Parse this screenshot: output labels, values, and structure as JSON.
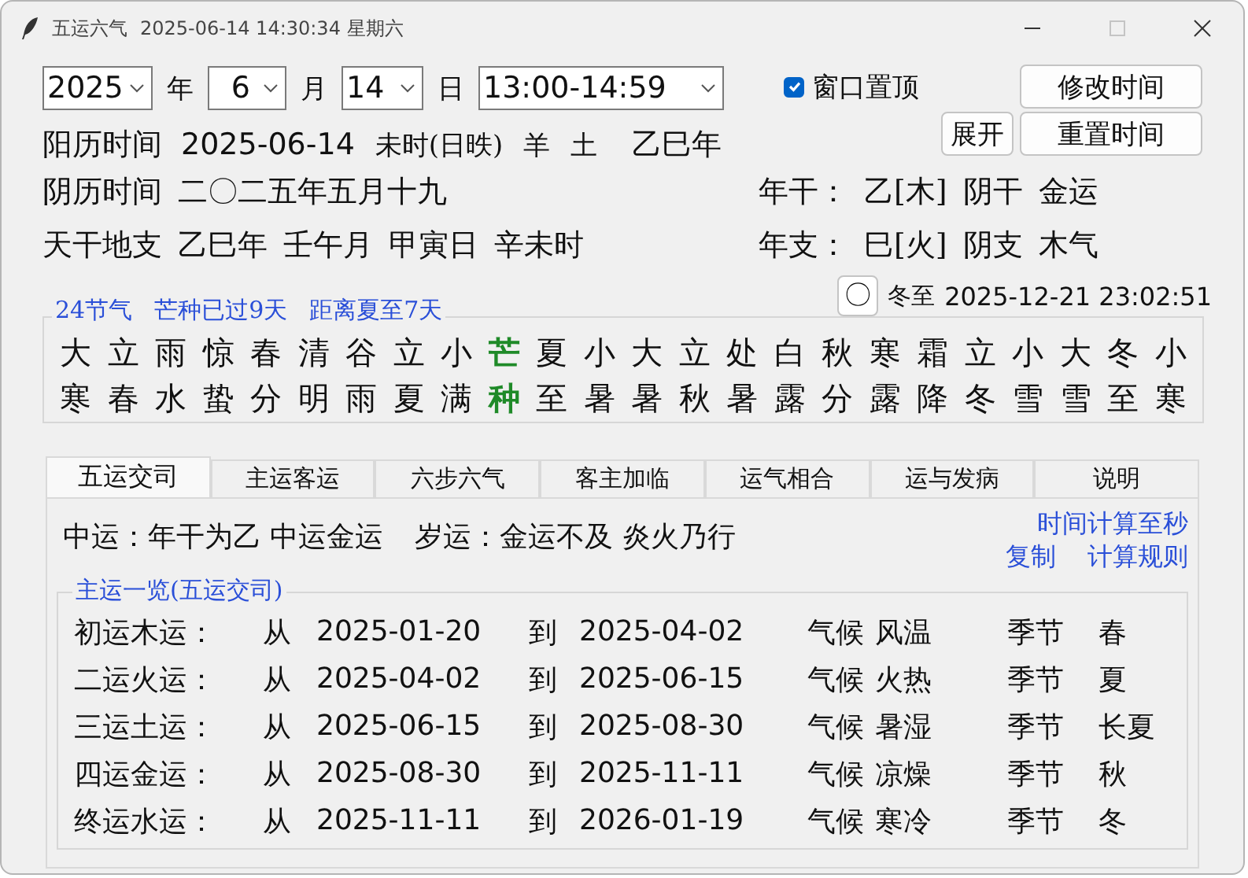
{
  "window": {
    "title": "五运六气",
    "timestamp": "2025-06-14 14:30:34 星期六",
    "maximize_disabled": true
  },
  "date_controls": {
    "year": "2025",
    "year_label": "年",
    "month": "6",
    "month_label": "月",
    "day": "14",
    "day_label": "日",
    "hour": "13:00-14:59"
  },
  "always_on_top": {
    "label": "窗口置顶",
    "checked": true
  },
  "buttons": {
    "modify": "修改时间",
    "expand": "展开",
    "reset": "重置时间"
  },
  "solar": {
    "label": "阳历时间",
    "date": "2025-06-14",
    "hour": "未时(日昳)",
    "zodiac": "羊",
    "element": "土",
    "year": "乙巳年"
  },
  "lunar": {
    "label": "阴历时间",
    "date": "二〇二五年五月十九"
  },
  "ganzhi": {
    "label": "天干地支",
    "items": [
      "乙巳年",
      "壬午月",
      "甲寅日",
      "辛未时"
    ]
  },
  "year_stem": {
    "label": "年干：",
    "value": "乙[木]",
    "polarity": "阴干",
    "fortune": "金运"
  },
  "year_branch": {
    "label": "年支：",
    "value": "巳[火]",
    "polarity": "阴支",
    "fortune": "木气"
  },
  "solar_terms": {
    "title": "24节气",
    "passed": "芒种已过9天",
    "next": "距离夏至7天",
    "button": "〇",
    "target_name": "冬至",
    "target_time": "2025-12-21 23:02:51",
    "terms": [
      {
        "name": "大寒",
        "selected": false
      },
      {
        "name": "立春",
        "selected": false
      },
      {
        "name": "雨水",
        "selected": false
      },
      {
        "name": "惊蛰",
        "selected": false
      },
      {
        "name": "春分",
        "selected": false
      },
      {
        "name": "清明",
        "selected": false
      },
      {
        "name": "谷雨",
        "selected": false
      },
      {
        "name": "立夏",
        "selected": false
      },
      {
        "name": "小满",
        "selected": false
      },
      {
        "name": "芒种",
        "selected": true
      },
      {
        "name": "夏至",
        "selected": false
      },
      {
        "name": "小暑",
        "selected": false
      },
      {
        "name": "大暑",
        "selected": false
      },
      {
        "name": "立秋",
        "selected": false
      },
      {
        "name": "处暑",
        "selected": false
      },
      {
        "name": "白露",
        "selected": false
      },
      {
        "name": "秋分",
        "selected": false
      },
      {
        "name": "寒露",
        "selected": false
      },
      {
        "name": "霜降",
        "selected": false
      },
      {
        "name": "立冬",
        "selected": false
      },
      {
        "name": "小雪",
        "selected": false
      },
      {
        "name": "大雪",
        "selected": false
      },
      {
        "name": "冬至",
        "selected": false
      },
      {
        "name": "小寒",
        "selected": false
      }
    ]
  },
  "tabs": [
    {
      "label": "五运交司",
      "selected": true
    },
    {
      "label": "主运客运",
      "selected": false
    },
    {
      "label": "六步六气",
      "selected": false
    },
    {
      "label": "客主加临",
      "selected": false
    },
    {
      "label": "运气相合",
      "selected": false
    },
    {
      "label": "运与发病",
      "selected": false
    },
    {
      "label": "说明",
      "selected": false
    }
  ],
  "panel": {
    "middle_fortune": "中运：年干为乙 中运金运",
    "year_fortune": "岁运：金运不及 炎火乃行",
    "links": [
      "时间计算至秒",
      "复制",
      "计算规则"
    ]
  },
  "main_fortunes": {
    "title": "主运一览(五运交司)",
    "rows": [
      {
        "name": "初运木运：",
        "from": "从",
        "start": "2025-01-20",
        "to": "到",
        "end": "2025-04-02",
        "climate_label": "气候",
        "climate": "风温",
        "season_label": "季节",
        "season": "春"
      },
      {
        "name": "二运火运：",
        "from": "从",
        "start": "2025-04-02",
        "to": "到",
        "end": "2025-06-15",
        "climate_label": "气候",
        "climate": "火热",
        "season_label": "季节",
        "season": "夏"
      },
      {
        "name": "三运土运：",
        "from": "从",
        "start": "2025-06-15",
        "to": "到",
        "end": "2025-08-30",
        "climate_label": "气候",
        "climate": "暑湿",
        "season_label": "季节",
        "season": "长夏"
      },
      {
        "name": "四运金运：",
        "from": "从",
        "start": "2025-08-30",
        "to": "到",
        "end": "2025-11-11",
        "climate_label": "气候",
        "climate": "凉燥",
        "season_label": "季节",
        "season": "秋"
      },
      {
        "name": "终运水运：",
        "from": "从",
        "start": "2025-11-11",
        "to": "到",
        "end": "2026-01-19",
        "climate_label": "气候",
        "climate": "寒冷",
        "season_label": "季节",
        "season": "冬"
      }
    ]
  }
}
